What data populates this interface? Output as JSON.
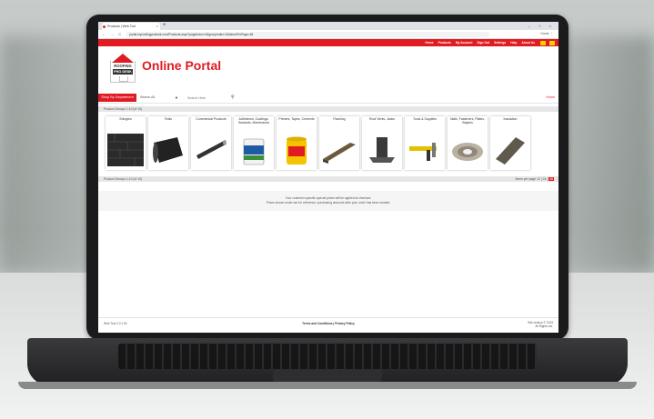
{
  "browser": {
    "tab_title": "Products | Web Tool",
    "tab_close": "×",
    "new_tab": "+",
    "window_controls": "– □ ×",
    "nav_buttons": "← → C",
    "url": "portal.myroofingprodesk.com/Products.aspx?pageIndex=0&groupIndex=0&itemsPerPage=48",
    "profile": "Guest ⋮"
  },
  "nav": {
    "items": [
      "Home",
      "Products",
      "My Account",
      "Sign Out",
      "Settings",
      "Help",
      "About Us"
    ],
    "accent": "#e01b22"
  },
  "header": {
    "logo_line1": "ROOFING",
    "logo_line2": "PRO DESK",
    "portal_title": "Online Portal"
  },
  "search": {
    "shop_button": "Shop By Department",
    "scope": "Search All",
    "scope_caret": "▼",
    "placeholder": "Search Here",
    "home_link": "Home"
  },
  "pagination": {
    "top_text": "Product Groups 1-10 (of 10)",
    "bottom_text": "Product Groups 1-10 (of 10)",
    "items_per_page_label": "Items per page 12 | 24 |",
    "items_per_page_active": "48"
  },
  "product_groups": [
    {
      "label": "Shingles",
      "icon": "shingles-icon"
    },
    {
      "label": "Rolls",
      "icon": "roll-icon"
    },
    {
      "label": "Commercial Products",
      "icon": "commercial-roll-icon"
    },
    {
      "label": "Adhesives, Coatings, Sealants, Membranes",
      "icon": "bucket-icon"
    },
    {
      "label": "Primers, Tapes, Cements",
      "icon": "yellow-can-icon"
    },
    {
      "label": "Flashing",
      "icon": "flashing-icon"
    },
    {
      "label": "Roof Vents, Jacks",
      "icon": "roof-jack-icon"
    },
    {
      "label": "Tools & Supplies",
      "icon": "caulk-gun-icon"
    },
    {
      "label": "Nails, Fasteners, Plates, Staples",
      "icon": "coil-nails-icon"
    },
    {
      "label": "Insulation",
      "icon": "insulation-board-icon"
    }
  ],
  "message": {
    "line1": "Your customer-specific special prices will be applied at checkout.",
    "line2": "Prices shown under are for reference; purchasing amounts after your order has been created."
  },
  "footer": {
    "left": "Web Tool 2.0.1.90",
    "middle": "Terms and Conditions | Privacy Policy",
    "right_line1": "Site version © 2024",
    "right_line2": "All Rights res."
  }
}
